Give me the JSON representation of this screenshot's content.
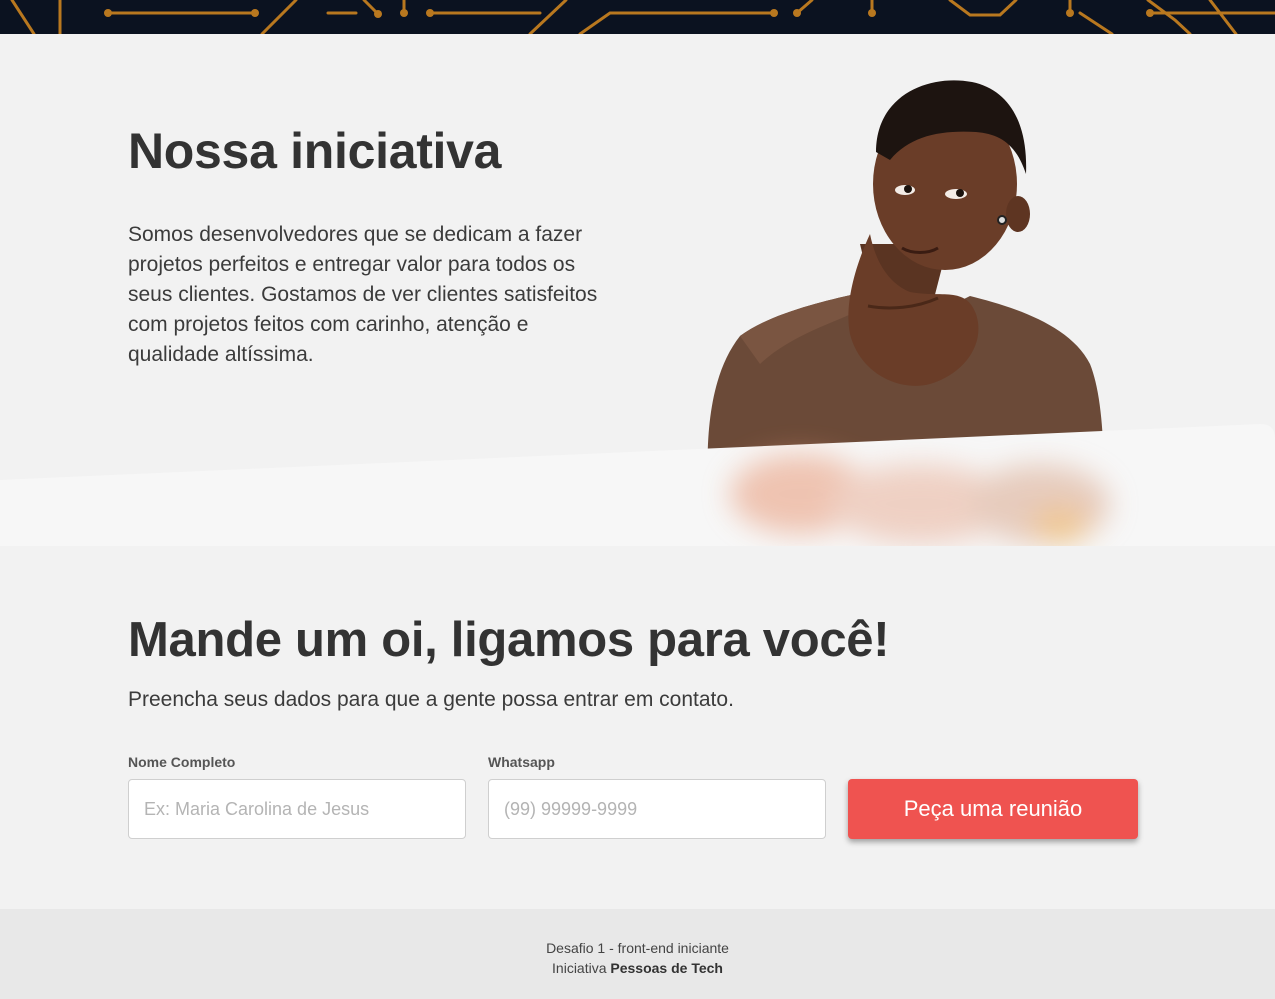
{
  "hero": {
    "title": "Nossa iniciativa",
    "text": "Somos desenvolvedores que se dedicam a fazer projetos perfeitos e entregar valor para todos os seus clientes. Gostamos de ver clientes satisfeitos com projetos feitos com carinho, atenção e qualidade altíssima."
  },
  "contact": {
    "title": "Mande um oi, ligamos para você!",
    "subtitle": "Preencha seus dados para que a gente possa entrar em contato.",
    "name_label": "Nome Completo",
    "name_placeholder": "Ex: Maria Carolina de Jesus",
    "phone_label": "Whatsapp",
    "phone_placeholder": "(99) 99999-9999",
    "button_label": "Peça uma reunião"
  },
  "footer": {
    "line1": "Desafio 1 - front-end iniciante",
    "line2_prefix": "Iniciativa ",
    "line2_bold": "Pessoas de Tech"
  },
  "colors": {
    "topbar_bg": "#0b1220",
    "circuit": "#b9781f",
    "accent_button": "#ef5350",
    "page_bg": "#f2f2f2",
    "footer_bg": "#e8e8e8"
  },
  "icons": [
    "circuit-pattern"
  ]
}
